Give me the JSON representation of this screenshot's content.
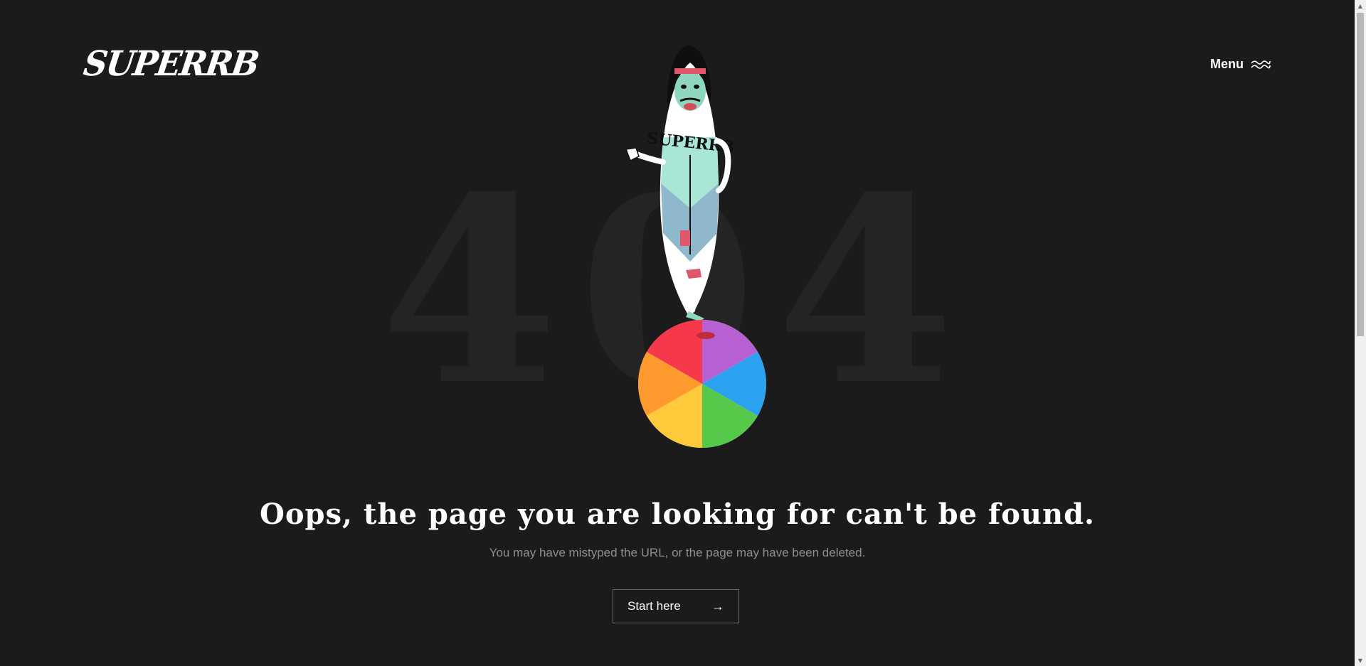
{
  "header": {
    "logo_text": "SUPERRB",
    "menu_label": "Menu"
  },
  "backdrop": {
    "text": "404"
  },
  "error": {
    "heading": "Oops, the page you are looking for can't be found.",
    "subtext": "You may have mistyped the URL, or the page may have been deleted.",
    "cta_label": "Start here",
    "cta_arrow": "→"
  },
  "illustration": {
    "board_text": "SUPERRB"
  },
  "colors": {
    "background": "#1b1b1c",
    "text": "#ffffff",
    "muted": "#8e8e8e",
    "backdrop": "#242425"
  },
  "icons": {
    "menu": "wavy-lines-icon",
    "cta": "arrow-right-icon"
  }
}
